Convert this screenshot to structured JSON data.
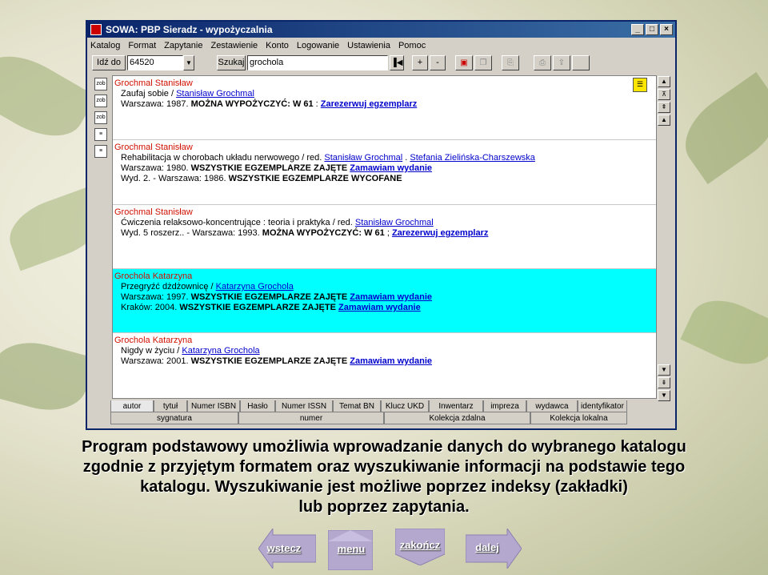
{
  "window": {
    "title": "SOWA: PBP Sieradz - wypożyczalnia",
    "controls": [
      "_",
      "□",
      "×"
    ]
  },
  "menu": [
    "Katalog",
    "Format",
    "Zapytanie",
    "Zestawienie",
    "Konto",
    "Logowanie",
    "Ustawienia",
    "Pomoc"
  ],
  "toolbar": {
    "goto_label": "Idź do",
    "goto_value": "64520",
    "search_label": "Szukaj",
    "search_value": "grochola",
    "plus": "+",
    "minus": "-"
  },
  "left_icons": [
    "zob",
    "zob",
    "zob",
    "doc",
    "doc"
  ],
  "records": [
    {
      "author": "Grochmal Stanisław",
      "lines": [
        [
          {
            "t": "Zaufaj sobie / "
          },
          {
            "t": "Stanisław Grochmal",
            "s": "lnk"
          }
        ],
        [
          {
            "t": "Warszawa: 1987. "
          },
          {
            "t": "MOŻNA WYPOŻYCZYĆ:  W 61",
            "s": "b"
          },
          {
            "t": " : "
          },
          {
            "t": "Zarezerwuj egzemplarz",
            "s": "lnkb"
          }
        ]
      ]
    },
    {
      "author": "Grochmal Stanisław",
      "lines": [
        [
          {
            "t": "Rehabilitacja w chorobach układu nerwowego / red. "
          },
          {
            "t": "Stanisław Grochmal",
            "s": "lnk"
          },
          {
            "t": " . "
          },
          {
            "t": "Stefania Zielińska-Charszewska",
            "s": "lnk"
          }
        ],
        [
          {
            "t": "Warszawa: 1980. "
          },
          {
            "t": "WSZYSTKIE EGZEMPLARZE ZAJĘTE",
            "s": "b"
          },
          {
            "t": " "
          },
          {
            "t": "Zamawiam wydanie",
            "s": "lnkb"
          }
        ],
        [
          {
            "t": "Wyd. 2. - Warszawa: 1986. "
          },
          {
            "t": "WSZYSTKIE EGZEMPLARZE WYCOFANE",
            "s": "b"
          }
        ]
      ]
    },
    {
      "author": "Grochmal Stanisław",
      "lines": [
        [
          {
            "t": "Ćwiczenia relaksowo-koncentrujące : teoria i praktyka / red. "
          },
          {
            "t": "Stanisław Grochmal",
            "s": "lnk"
          }
        ],
        [
          {
            "t": "Wyd. 5 roszerz.. - Warszawa: 1993. "
          },
          {
            "t": "MOŻNA WYPOŻYCZYĆ:  W 61",
            "s": "b"
          },
          {
            "t": " ; "
          },
          {
            "t": "Zarezerwuj egzemplarz",
            "s": "lnkb"
          }
        ]
      ]
    },
    {
      "author": "Grochola Katarzyna",
      "selected": true,
      "lines": [
        [
          {
            "t": "Przegryźć dżdżownicę / "
          },
          {
            "t": "Katarzyna Grochola",
            "s": "lnk"
          }
        ],
        [
          {
            "t": "Warszawa: 1997. "
          },
          {
            "t": "WSZYSTKIE EGZEMPLARZE ZAJĘTE",
            "s": "b"
          },
          {
            "t": " "
          },
          {
            "t": "Zamawiam wydanie",
            "s": "lnkb"
          }
        ],
        [
          {
            "t": "Kraków: 2004. "
          },
          {
            "t": "WSZYSTKIE EGZEMPLARZE ZAJĘTE",
            "s": "b"
          },
          {
            "t": " "
          },
          {
            "t": "Zamawiam wydanie",
            "s": "lnkb"
          }
        ]
      ]
    },
    {
      "author": "Grochola Katarzyna",
      "lines": [
        [
          {
            "t": "Nigdy w życiu / "
          },
          {
            "t": "Katarzyna Grochola",
            "s": "lnk"
          }
        ],
        [
          {
            "t": "Warszawa: 2001. "
          },
          {
            "t": "WSZYSTKIE EGZEMPLARZE ZAJĘTE",
            "s": "b"
          },
          {
            "t": " "
          },
          {
            "t": "Zamawiam wydanie",
            "s": "lnkb"
          }
        ]
      ]
    }
  ],
  "tabs_row1": [
    "autor",
    "tytuł",
    "Numer ISBN",
    "Hasło",
    "Numer ISSN",
    "Temat BN",
    "Klucz UKD",
    "Inwentarz",
    "impreza",
    "wydawca",
    "identyfikator"
  ],
  "tabs_row2": [
    "sygnatura",
    "numer",
    "Kolekcja zdalna",
    "Kolekcja lokalna"
  ],
  "caption": [
    "Program podstawowy umożliwia wprowadzanie danych do wybranego katalogu",
    "zgodnie z przyjętym formatem oraz wyszukiwanie informacji na podstawie tego",
    "katalogu. Wyszukiwanie jest możliwe poprzez indeksy (zakładki)",
    "lub poprzez zapytania."
  ],
  "nav": {
    "back": "wstecz",
    "menu": "menu",
    "end": "zakończ",
    "next": "dalej"
  }
}
